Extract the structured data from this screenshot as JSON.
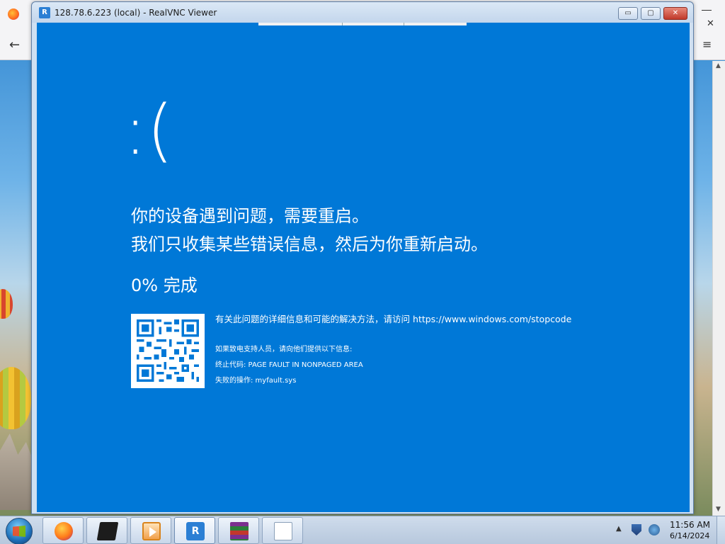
{
  "window": {
    "title": "128.78.6.223 (local) - RealVNC Viewer",
    "logo_text": "R",
    "min_symbol": "▭",
    "max_symbol": "▢",
    "close_symbol": "✕"
  },
  "bsod": {
    "sad_face": ":(",
    "line1": "你的设备遇到问题，需要重启。",
    "line2": "我们只收集某些错误信息，然后为你重新启动。",
    "progress": "0% 完成",
    "info_text": "有关此问题的详细信息和可能的解决方法，请访问",
    "info_url": "https://www.windows.com/stopcode",
    "support_line": "如果致电支持人员，请向他们提供以下信息:",
    "stop_code_line": "终止代码: PAGE FAULT IN NONPAGED AREA",
    "failed_op_line": "失败的操作: myfault.sys"
  },
  "background_browser": {
    "back_arrow": "←",
    "menu_icon": "≡",
    "close_symbol": "✕"
  },
  "taskbar": {
    "apps": [
      {
        "name": "firefox-icon"
      },
      {
        "name": "terminal-icon"
      },
      {
        "name": "media-player-icon"
      },
      {
        "name": "realvnc-icon",
        "label": "R"
      },
      {
        "name": "winrar-icon"
      },
      {
        "name": "notepad-icon"
      }
    ],
    "tray_arrow": "▲",
    "clock_time": "11:56 AM",
    "clock_date": "6/14/2024"
  },
  "colors": {
    "bsod_blue": "#0078d7",
    "taskbar": "#c8d7ea",
    "title_bar": "#cfe0f2"
  }
}
